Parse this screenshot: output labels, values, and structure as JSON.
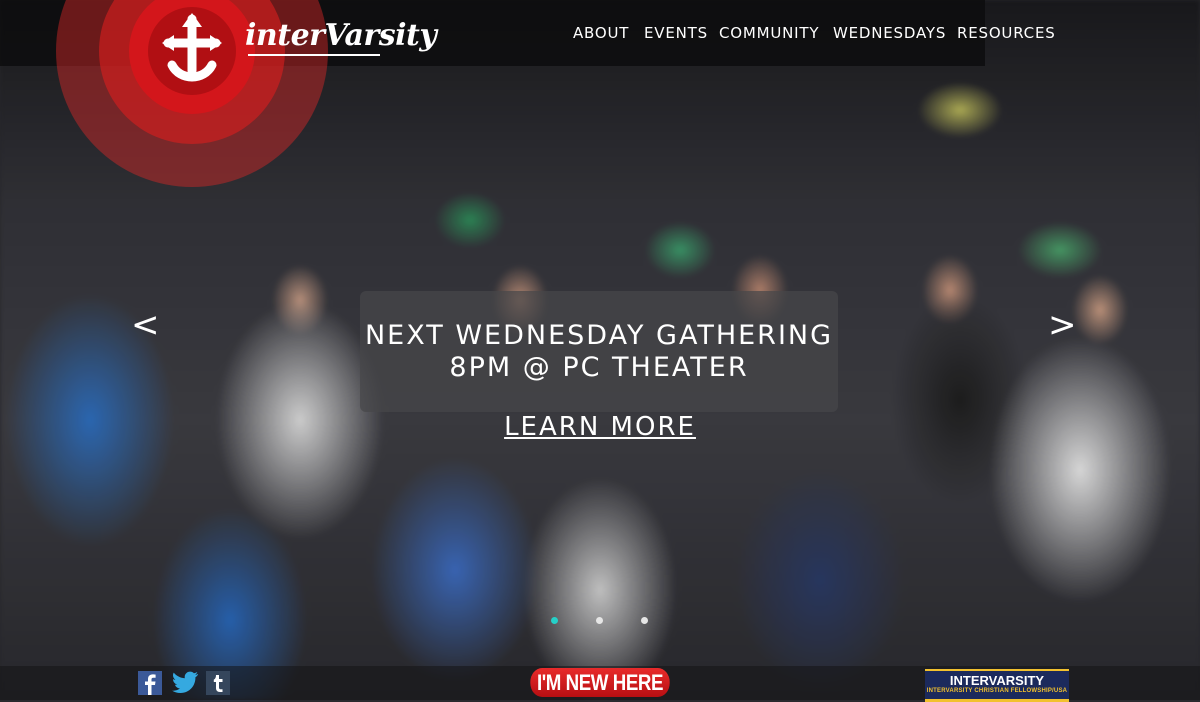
{
  "brand": {
    "name": "interVarsity"
  },
  "nav": {
    "items": [
      {
        "label": "ABOUT"
      },
      {
        "label": "EVENTS"
      },
      {
        "label": "COMMUNITY"
      },
      {
        "label": "WEDNESDAYS"
      },
      {
        "label": "RESOURCES"
      }
    ]
  },
  "slide": {
    "line1": "NEXT WEDNESDAY GATHERING",
    "line2": "8PM @ PC THEATER",
    "cta": "LEARN MORE",
    "prev_label": "<",
    "next_label": ">",
    "dots": 3,
    "active_dot": 1
  },
  "footer": {
    "social": [
      {
        "icon": "facebook-icon",
        "glyph": "f"
      },
      {
        "icon": "twitter-icon"
      },
      {
        "icon": "tumblr-icon",
        "glyph": "t"
      }
    ],
    "new_here_label": "I'M NEW HERE",
    "badge_title": "INTERVARSITY",
    "badge_subtitle": "INTERVARSITY CHRISTIAN FELLOWSHIP/USA"
  },
  "colors": {
    "accent_red": "#d3161b",
    "active_dot": "#25d0c8",
    "badge_blue": "#1c2a5c",
    "badge_gold": "#f2c12e"
  }
}
